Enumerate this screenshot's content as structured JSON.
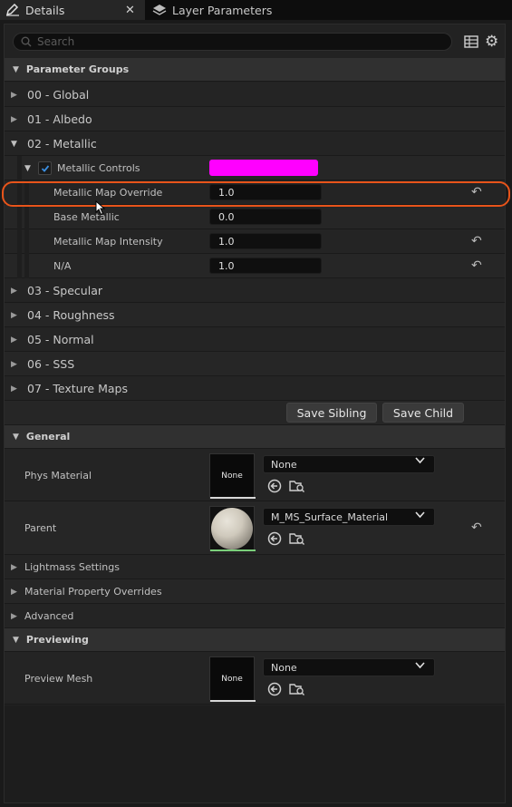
{
  "tabs": [
    {
      "label": "Details",
      "icon": "edit-icon",
      "active": true
    },
    {
      "label": "Layer Parameters",
      "icon": "layers-icon",
      "active": false
    }
  ],
  "search": {
    "placeholder": "Search",
    "value": ""
  },
  "parameter_groups": {
    "title": "Parameter Groups",
    "groups": [
      "00 - Global",
      "01 - Albedo",
      "02 - Metallic",
      "03 - Specular",
      "04 - Roughness",
      "05 - Normal",
      "06 - SSS",
      "07 - Texture Maps"
    ],
    "metallic": {
      "controls_label": "Metallic Controls",
      "controls_color": "#ff00ff",
      "params": [
        {
          "label": "Metallic Map Override",
          "value": "1.0"
        },
        {
          "label": "Base Metallic",
          "value": "0.0"
        },
        {
          "label": "Metallic Map Intensity",
          "value": "1.0"
        },
        {
          "label": "N/A",
          "value": "1.0"
        }
      ]
    },
    "save_sibling": "Save Sibling",
    "save_child": "Save Child"
  },
  "general": {
    "title": "General",
    "phys_material": {
      "label": "Phys Material",
      "thumb": "None",
      "value": "None"
    },
    "parent": {
      "label": "Parent",
      "value": "M_MS_Surface_Material"
    },
    "collapsed": [
      "Lightmass Settings",
      "Material Property Overrides",
      "Advanced"
    ]
  },
  "previewing": {
    "title": "Previewing",
    "preview_mesh": {
      "label": "Preview Mesh",
      "thumb": "None",
      "value": "None"
    }
  },
  "colors": {
    "accent": "#ff00ff",
    "highlight": "#e8541a",
    "checkbox": "#1a5fb4"
  }
}
